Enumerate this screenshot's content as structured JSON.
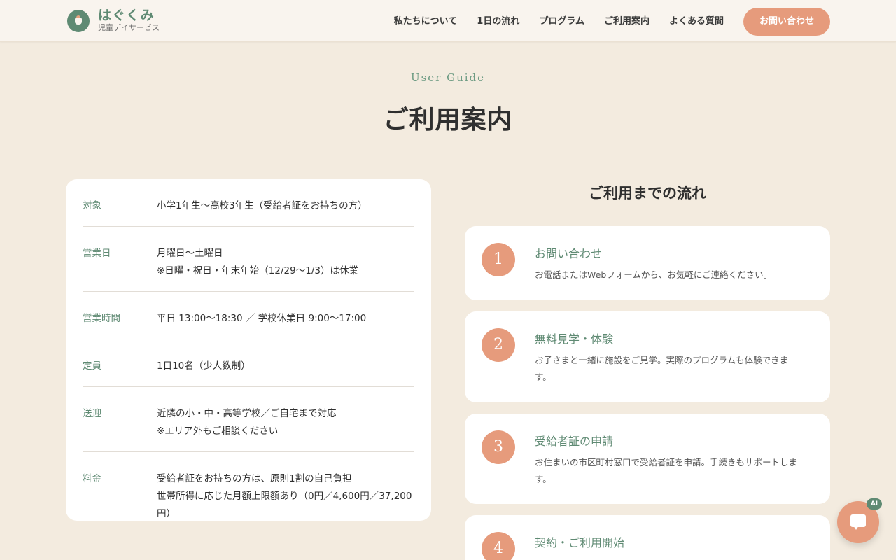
{
  "header": {
    "logo_name": "はぐくみ",
    "logo_sub": "児童デイサービス",
    "nav": [
      "私たちについて",
      "1日の流れ",
      "プログラム",
      "ご利用案内",
      "よくある質問"
    ],
    "cta": "お問い合わせ"
  },
  "section": {
    "eyebrow": "User Guide",
    "title": "ご利用案内"
  },
  "info": [
    {
      "label": "対象",
      "lines": [
        "小学1年生〜高校3年生（受給者証をお持ちの方）"
      ]
    },
    {
      "label": "営業日",
      "lines": [
        "月曜日〜土曜日",
        "※日曜・祝日・年末年始（12/29〜1/3）は休業"
      ]
    },
    {
      "label": "営業時間",
      "lines": [
        "平日 13:00〜18:30 ／ 学校休業日 9:00〜17:00"
      ]
    },
    {
      "label": "定員",
      "lines": [
        "1日10名（少人数制）"
      ]
    },
    {
      "label": "送迎",
      "lines": [
        "近隣の小・中・高等学校／ご自宅まで対応",
        "※エリア外もご相談ください"
      ]
    },
    {
      "label": "料金",
      "lines": [
        "受給者証をお持ちの方は、原則1割の自己負担",
        "世帯所得に応じた月額上限額あり（0円／4,600円／37,200",
        "円）"
      ]
    }
  ],
  "flow": {
    "title": "ご利用までの流れ",
    "steps": [
      {
        "num": "1",
        "title": "お問い合わせ",
        "desc_lines": [
          "お電話またはWebフォームから、お気軽にご連絡ください。"
        ]
      },
      {
        "num": "2",
        "title": "無料見学・体験",
        "desc_lines": [
          "お子さまと一緒に施設をご見学。実際のプログラムも体験できま",
          "す。"
        ]
      },
      {
        "num": "3",
        "title": "受給者証の申請",
        "desc_lines": [
          "お住まいの市区町村窓口で受給者証を申請。手続きもサポートしま",
          "す。"
        ]
      },
      {
        "num": "4",
        "title": "契約・ご利用開始",
        "desc_lines": []
      }
    ]
  },
  "chat": {
    "badge": "AI",
    "icon": "chat-bubble-icon"
  },
  "colors": {
    "background": "#f3ebdf",
    "accent": "#e69b7c",
    "brand_green": "#5f8a73"
  }
}
